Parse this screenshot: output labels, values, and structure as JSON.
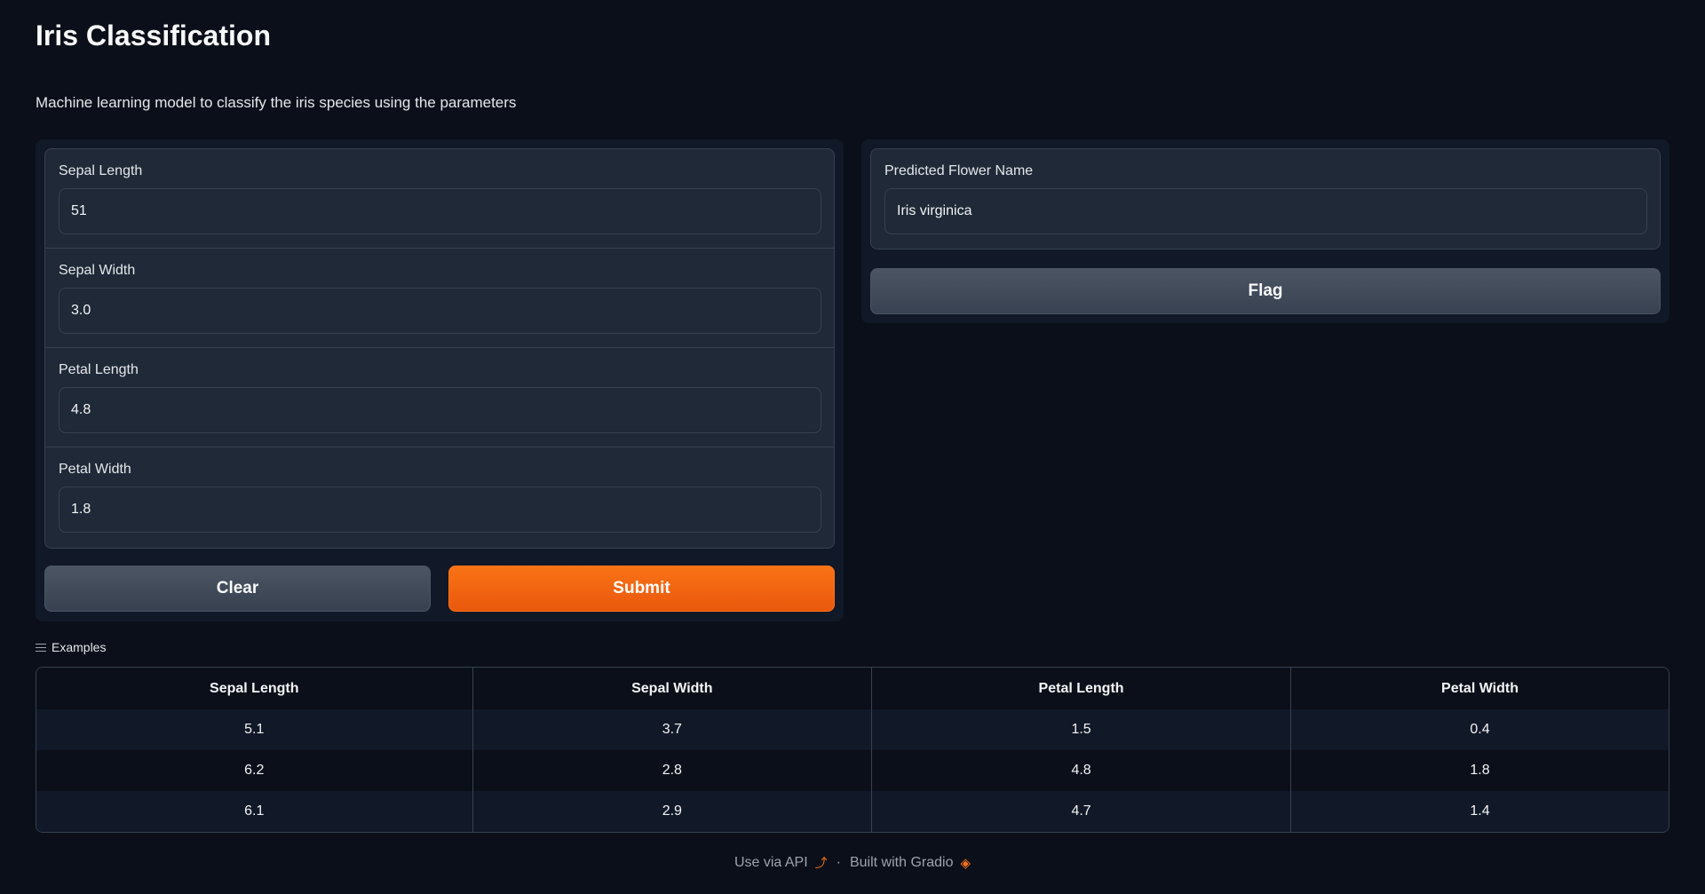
{
  "app": {
    "title": "Iris Classification",
    "description": "Machine learning model to classify the iris species using the parameters"
  },
  "inputs": [
    {
      "label": "Sepal Length",
      "value": "51"
    },
    {
      "label": "Sepal Width",
      "value": "3.0"
    },
    {
      "label": "Petal Length",
      "value": "4.8"
    },
    {
      "label": "Petal Width",
      "value": "1.8"
    }
  ],
  "buttons": {
    "clear": "Clear",
    "submit": "Submit",
    "flag": "Flag"
  },
  "output": {
    "label": "Predicted Flower Name",
    "value": "Iris virginica"
  },
  "examples": {
    "label": "Examples",
    "headers": [
      "Sepal Length",
      "Sepal Width",
      "Petal Length",
      "Petal Width"
    ],
    "rows": [
      [
        "5.1",
        "3.7",
        "1.5",
        "0.4"
      ],
      [
        "6.2",
        "2.8",
        "4.8",
        "1.8"
      ],
      [
        "6.1",
        "2.9",
        "4.7",
        "1.4"
      ]
    ]
  },
  "footer": {
    "api_link": "Use via API",
    "separator": "·",
    "built_with": "Built with Gradio"
  },
  "colors": {
    "background": "#0b0f19",
    "panel": "#111827",
    "block": "#1f2937",
    "border": "#374151",
    "primary": "#f97316"
  },
  "icons": {
    "examples": "list-icon",
    "api": "rocket-icon",
    "gradio": "gradio-logo-icon"
  }
}
